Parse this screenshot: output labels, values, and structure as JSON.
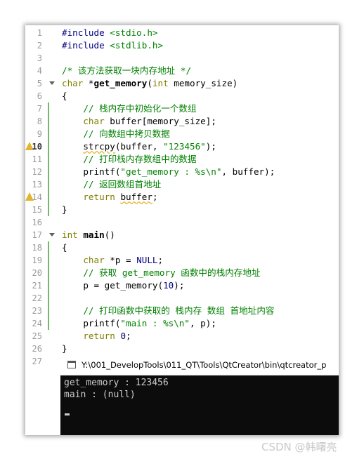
{
  "editor": {
    "line_numbers": [
      "1",
      "2",
      "3",
      "4",
      "5",
      "6",
      "7",
      "8",
      "9",
      "10",
      "11",
      "12",
      "13",
      "14",
      "15",
      "16",
      "17",
      "18",
      "19",
      "20",
      "21",
      "22",
      "23",
      "24",
      "25",
      "26",
      "27"
    ],
    "lines": {
      "l1": [
        "#include",
        " <stdio.h>"
      ],
      "l2": [
        "#include",
        " <stdlib.h>"
      ],
      "l4": "/* 该方法获取一块内存地址 */",
      "l5": [
        "char",
        " *",
        "get_memory",
        "(",
        "int",
        " memory_size)"
      ],
      "l6": "{",
      "l7": "    // 栈内存中初始化一个数组",
      "l8": [
        "    ",
        "char",
        " buffer[memory_size];"
      ],
      "l9": "    // 向数组中拷贝数据",
      "l10": [
        "    ",
        "strcpy",
        "(buffer, ",
        "\"123456\"",
        ");"
      ],
      "l11": "    // 打印栈内存数组中的数据",
      "l12": [
        "    printf(",
        "\"get_memory : %s\\n\"",
        ", buffer);"
      ],
      "l13": "    // 返回数组首地址",
      "l14": [
        "    ",
        "return",
        " ",
        "buffer",
        ";"
      ],
      "l15": "}",
      "l17": [
        "int",
        " ",
        "main",
        "()"
      ],
      "l18": "{",
      "l19": [
        "    ",
        "char",
        " *p = ",
        "NULL",
        ";"
      ],
      "l20": "    // 获取 get_memory 函数中的栈内存地址",
      "l21": [
        "    p = get_memory(",
        "10",
        ");"
      ],
      "l23": "    // 打印函数中获取的 栈内存 数组 首地址内容",
      "l24": [
        "    printf(",
        "\"main : %s\\n\"",
        ", p);"
      ],
      "l25": [
        "    ",
        "return",
        " ",
        "0",
        ";"
      ],
      "l26": "}"
    }
  },
  "console": {
    "title": "Y:\\001_DevelopTools\\011_QT\\Tools\\QtCreator\\bin\\qtcreator_p",
    "output": [
      "get_memory : 123456",
      "main : (null)"
    ]
  },
  "watermark": "CSDN @韩曙亮",
  "colors": {
    "keyword": "#808000",
    "comment": "#008000",
    "string": "#008000",
    "number": "#000080",
    "line_number": "#9b9b9b",
    "change_marker": "#74b86a",
    "warning": "#e3b42d",
    "console_bg": "#0c0c0c",
    "console_text": "#cccccc"
  }
}
